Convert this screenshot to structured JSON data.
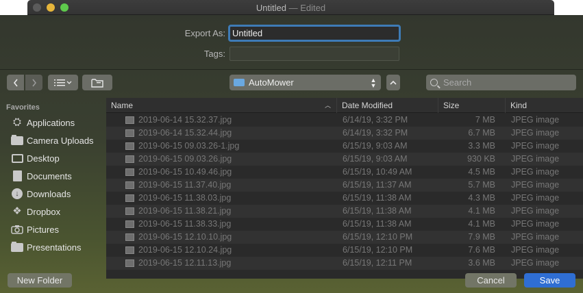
{
  "window": {
    "title": "Untitled",
    "edited_suffix": "— Edited"
  },
  "form": {
    "export_label": "Export As:",
    "export_value": "Untitled",
    "tags_label": "Tags:",
    "tags_value": ""
  },
  "toolbar": {
    "back_icon": "chevron-left-icon",
    "forward_icon": "chevron-right-icon",
    "view_icon": "list-view-icon",
    "new_folder_icon": "folder-icon",
    "location": "AutoMower",
    "search_placeholder": "Search"
  },
  "sidebar": {
    "heading": "Favorites",
    "items": [
      {
        "label": "Applications",
        "icon": "applications-icon"
      },
      {
        "label": "Camera Uploads",
        "icon": "folder-icon"
      },
      {
        "label": "Desktop",
        "icon": "desktop-icon"
      },
      {
        "label": "Documents",
        "icon": "documents-icon"
      },
      {
        "label": "Downloads",
        "icon": "downloads-icon"
      },
      {
        "label": "Dropbox",
        "icon": "dropbox-icon"
      },
      {
        "label": "Pictures",
        "icon": "camera-icon"
      },
      {
        "label": "Presentations",
        "icon": "folder-icon"
      }
    ]
  },
  "columns": {
    "name": "Name",
    "date": "Date Modified",
    "size": "Size",
    "kind": "Kind"
  },
  "files": [
    {
      "name": "2019-06-14 15.32.37.jpg",
      "date": "6/14/19, 3:32 PM",
      "size": "7 MB",
      "kind": "JPEG image"
    },
    {
      "name": "2019-06-14 15.32.44.jpg",
      "date": "6/14/19, 3:32 PM",
      "size": "6.7 MB",
      "kind": "JPEG image"
    },
    {
      "name": "2019-06-15 09.03.26-1.jpg",
      "date": "6/15/19, 9:03 AM",
      "size": "3.3 MB",
      "kind": "JPEG image"
    },
    {
      "name": "2019-06-15 09.03.26.jpg",
      "date": "6/15/19, 9:03 AM",
      "size": "930 KB",
      "kind": "JPEG image"
    },
    {
      "name": "2019-06-15 10.49.46.jpg",
      "date": "6/15/19, 10:49 AM",
      "size": "4.5 MB",
      "kind": "JPEG image"
    },
    {
      "name": "2019-06-15 11.37.40.jpg",
      "date": "6/15/19, 11:37 AM",
      "size": "5.7 MB",
      "kind": "JPEG image"
    },
    {
      "name": "2019-06-15 11.38.03.jpg",
      "date": "6/15/19, 11:38 AM",
      "size": "4.3 MB",
      "kind": "JPEG image"
    },
    {
      "name": "2019-06-15 11.38.21.jpg",
      "date": "6/15/19, 11:38 AM",
      "size": "4.1 MB",
      "kind": "JPEG image"
    },
    {
      "name": "2019-06-15 11.38.33.jpg",
      "date": "6/15/19, 11:38 AM",
      "size": "4.1 MB",
      "kind": "JPEG image"
    },
    {
      "name": "2019-06-15 12.10.10.jpg",
      "date": "6/15/19, 12:10 PM",
      "size": "7.9 MB",
      "kind": "JPEG image"
    },
    {
      "name": "2019-06-15 12.10.24.jpg",
      "date": "6/15/19, 12:10 PM",
      "size": "7.6 MB",
      "kind": "JPEG image"
    },
    {
      "name": "2019-06-15 12.11.13.jpg",
      "date": "6/15/19, 12:11 PM",
      "size": "3.6 MB",
      "kind": "JPEG image"
    }
  ],
  "buttons": {
    "new_folder": "New Folder",
    "cancel": "Cancel",
    "save": "Save"
  }
}
